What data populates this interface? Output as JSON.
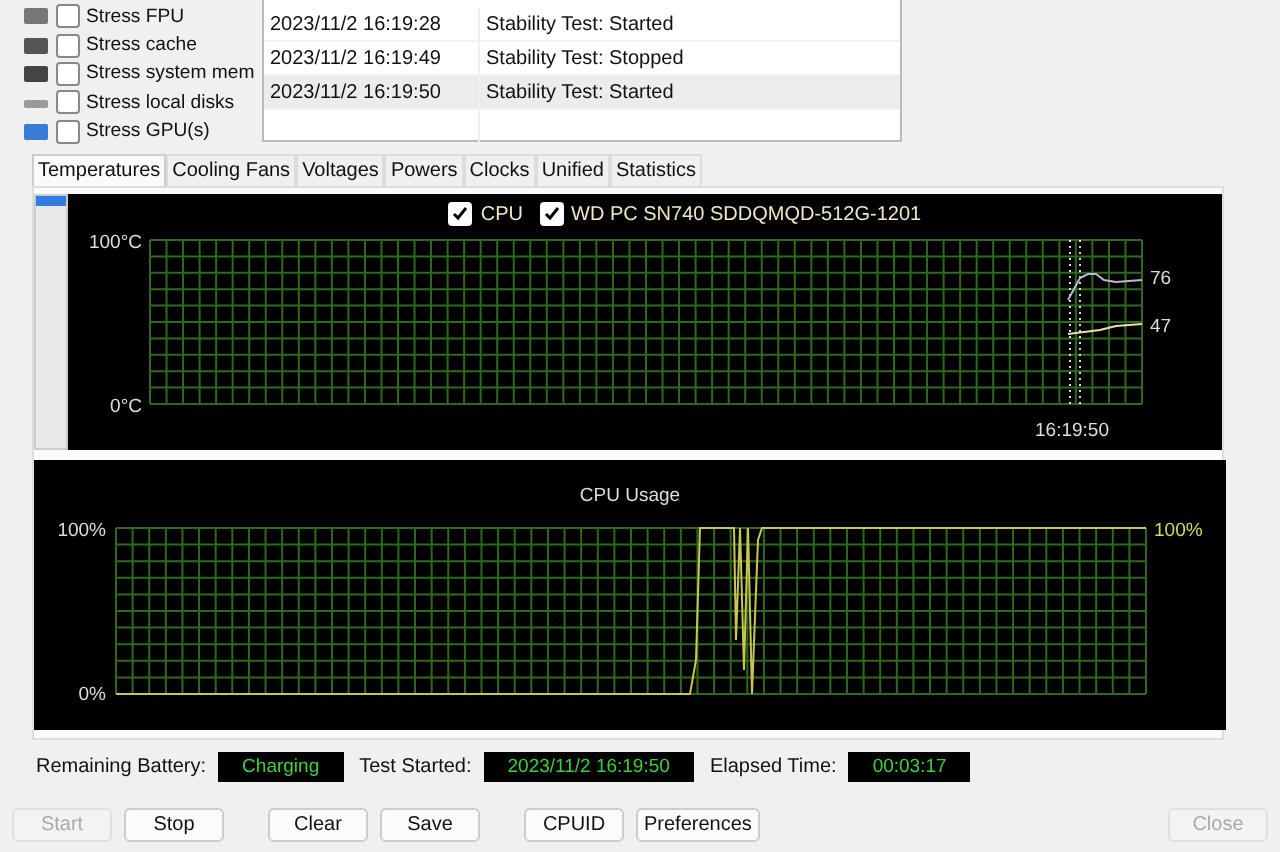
{
  "stress_options": [
    {
      "kind": "fpu",
      "label": "Stress FPU",
      "checked": false
    },
    {
      "kind": "cache",
      "label": "Stress cache",
      "checked": false
    },
    {
      "kind": "memory",
      "label": "Stress system mem",
      "checked": false
    },
    {
      "kind": "disk",
      "label": "Stress local disks",
      "checked": false
    },
    {
      "kind": "gpu",
      "label": "Stress GPU(s)",
      "checked": false
    }
  ],
  "log": {
    "rows": [
      {
        "date_time": "2023/11/2 16:19:28",
        "status": "Stability Test: Started",
        "selected": false
      },
      {
        "date_time": "2023/11/2 16:19:49",
        "status": "Stability Test: Stopped",
        "selected": false
      },
      {
        "date_time": "2023/11/2 16:19:50",
        "status": "Stability Test: Started",
        "selected": true
      }
    ]
  },
  "tabs": [
    {
      "label": "Temperatures",
      "selected": true
    },
    {
      "label": "Cooling Fans",
      "selected": false
    },
    {
      "label": "Voltages",
      "selected": false
    },
    {
      "label": "Powers",
      "selected": false
    },
    {
      "label": "Clocks",
      "selected": false
    },
    {
      "label": "Unified",
      "selected": false
    },
    {
      "label": "Statistics",
      "selected": false
    }
  ],
  "temperature_graph": {
    "legend": [
      {
        "label": "CPU",
        "checked": true
      },
      {
        "label": "WD PC SN740 SDDQMQD-512G-1201",
        "checked": true
      }
    ],
    "y_max_label": "100°C",
    "y_min_label": "0°C",
    "readings": [
      "76",
      "47"
    ],
    "time_label": "16:19:50"
  },
  "cpu_graph": {
    "title": "CPU Usage",
    "y_max_label": "100%",
    "y_min_label": "0%",
    "reading": "100%"
  },
  "status": [
    {
      "label": "Remaining Battery:",
      "value": "Charging"
    },
    {
      "label": "Test Started:",
      "value": "2023/11/2 16:19:50"
    },
    {
      "label": "Elapsed Time:",
      "value": "00:03:17"
    }
  ],
  "button_groups": [
    [
      {
        "label": "Start",
        "disabled": true
      },
      {
        "label": "Stop",
        "disabled": false
      }
    ],
    [
      {
        "label": "Clear",
        "disabled": false
      },
      {
        "label": "Save",
        "disabled": false
      }
    ],
    [
      {
        "label": "CPUID",
        "disabled": false
      },
      {
        "label": "Preferences",
        "disabled": false
      }
    ],
    [
      {
        "label": "Close",
        "disabled": true
      }
    ]
  ]
}
